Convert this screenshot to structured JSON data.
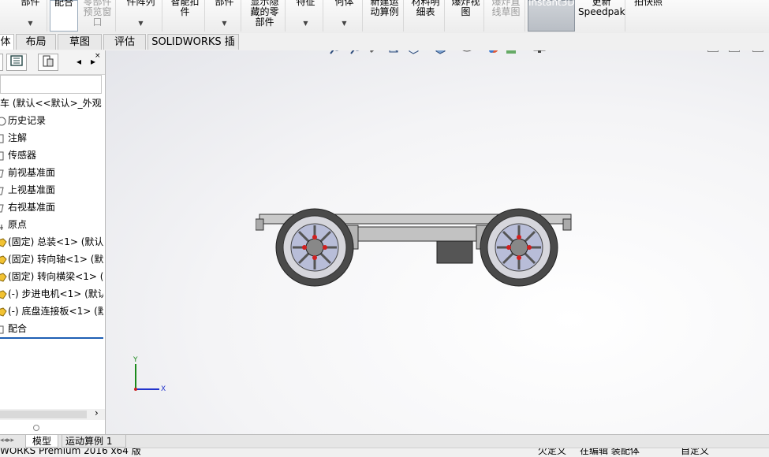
{
  "ribbon": {
    "buttons": [
      {
        "label": "部件",
        "disabled": false
      },
      {
        "label": "配合",
        "disabled": false
      },
      {
        "label": "零部件\n预览窗\n口",
        "disabled": true
      },
      {
        "label": "件阵列",
        "disabled": false
      },
      {
        "label": "智能扣\n件",
        "disabled": false
      },
      {
        "label": "部件",
        "disabled": false
      },
      {
        "label": "显示隐\n藏的零\n部件",
        "disabled": false
      },
      {
        "label": "特征",
        "disabled": false
      },
      {
        "label": "何体",
        "disabled": false
      },
      {
        "label": "新建运\n动算例",
        "disabled": false
      },
      {
        "label": "材料明\n细表",
        "disabled": false
      },
      {
        "label": "爆炸视\n图",
        "disabled": false
      },
      {
        "label": "爆炸直\n线草图",
        "disabled": true
      },
      {
        "label": "Instant3D",
        "disabled": false
      },
      {
        "label": "更新\nSpeedpak",
        "disabled": false
      },
      {
        "label": "拍快照",
        "disabled": false
      }
    ]
  },
  "tabs": [
    {
      "label": "体",
      "active": true
    },
    {
      "label": "布局",
      "active": false
    },
    {
      "label": "草图",
      "active": false
    },
    {
      "label": "评估",
      "active": false
    },
    {
      "label": "SOLIDWORKS 插件",
      "active": false
    }
  ],
  "tree": {
    "root": "车 (默认<<默认>_外观",
    "items": [
      {
        "label": "历史记录",
        "icon": "history-icon"
      },
      {
        "label": "注解",
        "icon": "annotation-icon"
      },
      {
        "label": "传感器",
        "icon": "sensor-icon"
      },
      {
        "label": "前视基准面",
        "icon": "plane-icon"
      },
      {
        "label": "上视基准面",
        "icon": "plane-icon"
      },
      {
        "label": "右视基准面",
        "icon": "plane-icon"
      },
      {
        "label": "原点",
        "icon": "origin-icon"
      },
      {
        "label": "(固定) 总装<1> (默认<",
        "icon": "assembly-icon"
      },
      {
        "label": "(固定) 转向轴<1> (默认",
        "icon": "part-icon"
      },
      {
        "label": "(固定) 转向横梁<1> (默",
        "icon": "part-icon"
      },
      {
        "label": "(-) 步进电机<1> (默认",
        "icon": "part-icon"
      },
      {
        "label": "(-) 底盘连接板<1> (默",
        "icon": "part-icon"
      },
      {
        "label": "配合",
        "icon": "mates-icon"
      }
    ]
  },
  "triad": {
    "y": "Y",
    "x": "X"
  },
  "bottom_tabs": [
    "模型",
    "运动算例 1"
  ],
  "status": {
    "left": "WORKS Premium 2016 x64 版",
    "mid1": "欠定义",
    "mid2": "在编辑 装配体",
    "right": "自定义"
  },
  "colors": {
    "accent": "#1e5fb4",
    "viewport_bg": "#f4f4f6"
  }
}
